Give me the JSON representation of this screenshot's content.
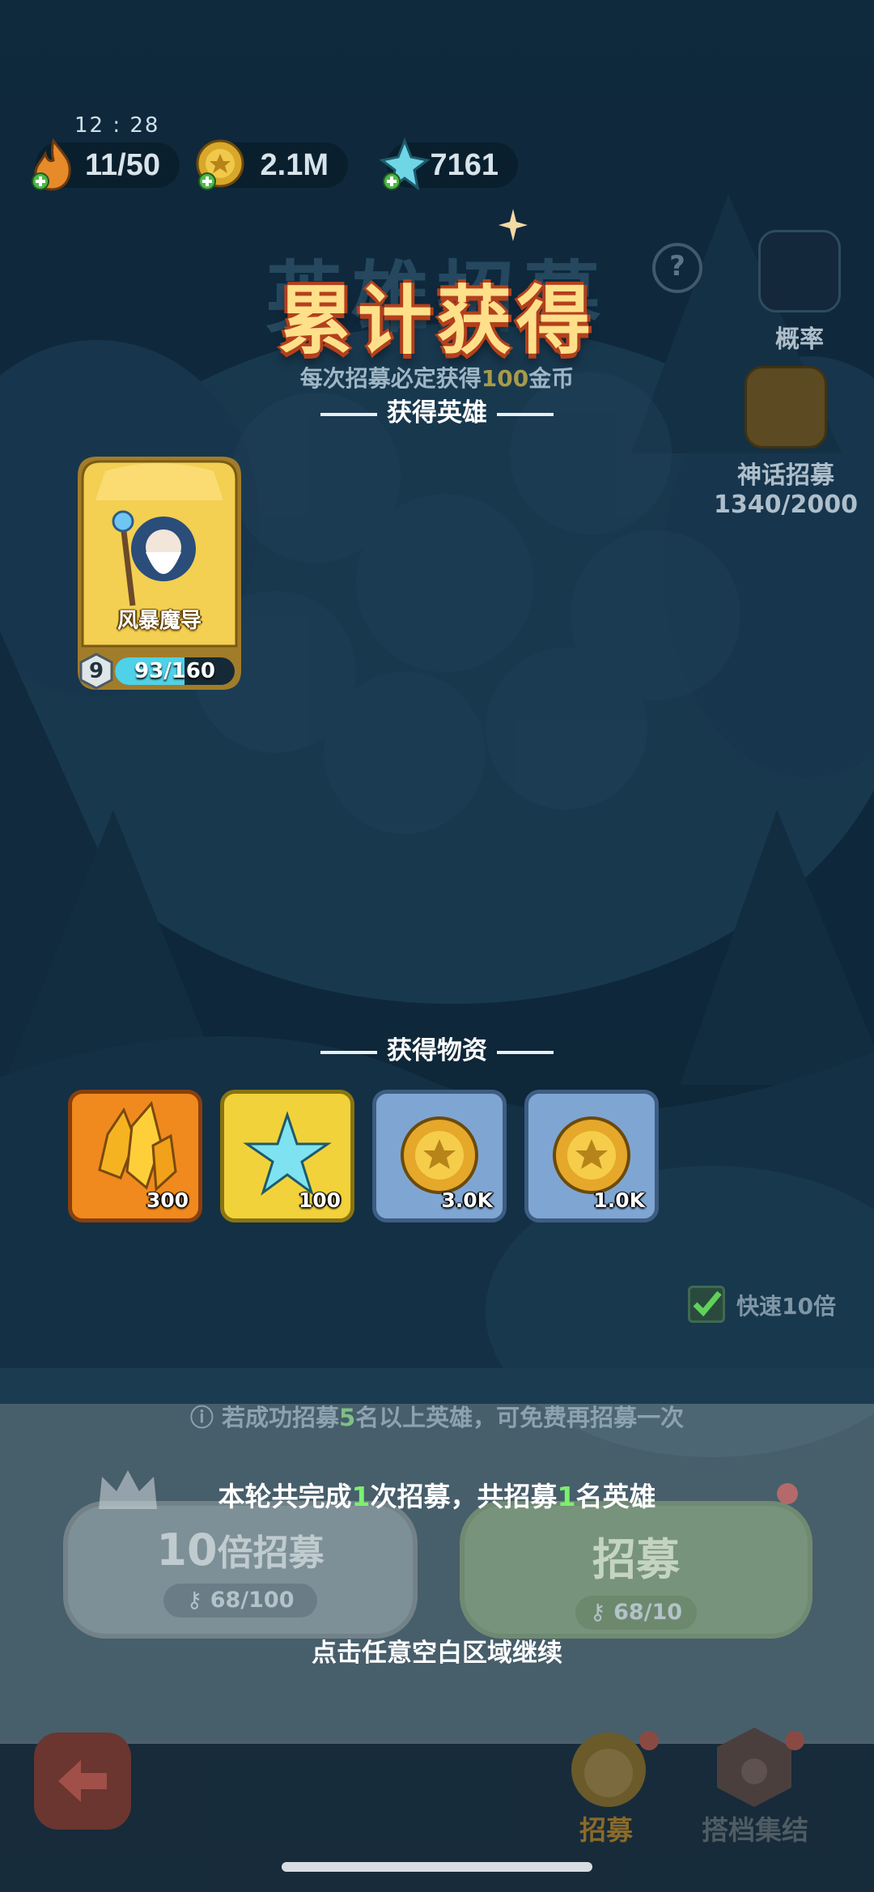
{
  "status": {
    "time": "12 : 28"
  },
  "resources": [
    {
      "icon": "energy-flame-icon",
      "value": "11/50"
    },
    {
      "icon": "gold-coin-icon",
      "value": "2.1M"
    },
    {
      "icon": "crystal-shard-icon",
      "value": "7161"
    }
  ],
  "header": {
    "bg_title": "英雄招募",
    "title": "累计获得",
    "subtitle_prefix": "每次招募必定获得",
    "subtitle_amount": "100",
    "subtitle_suffix": "金币"
  },
  "side": {
    "rates_label": "概率",
    "myth_label": "神话招募",
    "myth_progress": "1340/2000"
  },
  "heroes_section": {
    "title": "获得英雄"
  },
  "hero": {
    "name": "风暴魔导",
    "level": "9",
    "progress_text": "93/160",
    "progress_fraction": 0.58
  },
  "items_section": {
    "title": "获得物资"
  },
  "items": [
    {
      "icon": "gold-crystal-icon",
      "qty": "300",
      "rarity": "legendary"
    },
    {
      "icon": "snowflake-crystal-icon",
      "qty": "100",
      "rarity": "epic"
    },
    {
      "icon": "gold-coin-icon",
      "qty": "3.0K",
      "rarity": "common"
    },
    {
      "icon": "gold-coin-icon",
      "qty": "1.0K",
      "rarity": "common"
    }
  ],
  "fast_toggle": {
    "label": "快速10倍",
    "checked": true
  },
  "tip": {
    "pre": "若成功招募",
    "num": "5",
    "post": "名以上英雄，可免费再招募一次"
  },
  "summary": {
    "p1": "本轮共完成",
    "n1": "1",
    "p2": "次招募，共招募",
    "n2": "1",
    "p3": "名英雄"
  },
  "continue_text": "点击任意空白区域继续",
  "buttons": {
    "ten": {
      "label_num": "10",
      "label_text": "倍招募",
      "cost": "68/100"
    },
    "one": {
      "label": "招募",
      "cost": "68/10"
    }
  },
  "nav": {
    "recruit": "招募",
    "team": "搭档集结"
  },
  "colors": {
    "accent_green": "#7bf06e",
    "title_gold": "#ffe08a",
    "legendary": "#f08a1e",
    "epic": "#f2d23a",
    "common": "#7fa6d2"
  }
}
